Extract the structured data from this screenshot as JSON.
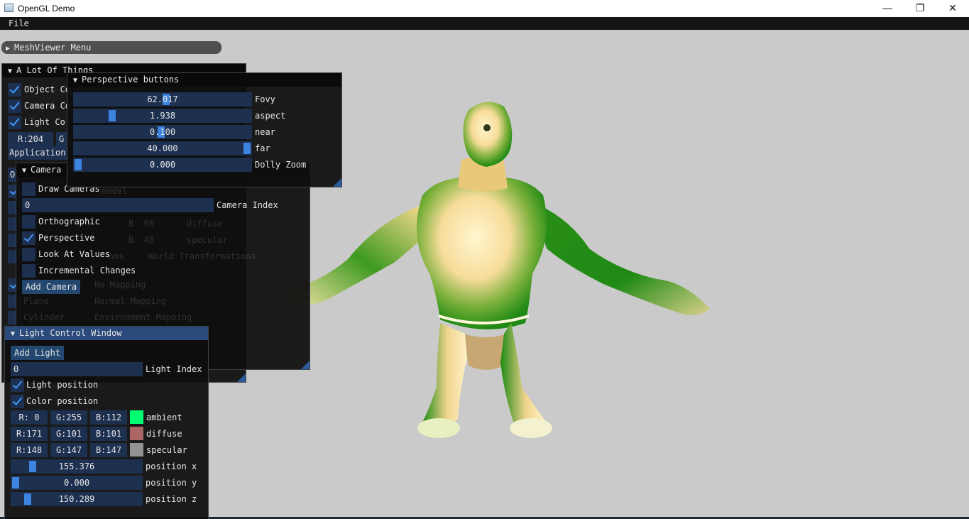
{
  "window": {
    "title": "OpenGL Demo",
    "minimize": "—",
    "maximize": "❐",
    "close": "✕"
  },
  "menubar": {
    "file": "File"
  },
  "meshviewer_menu": {
    "title": "MeshViewer Menu"
  },
  "a_lot_of_things": {
    "title": "A Lot Of Things",
    "object_control": "Object Co",
    "camera_control": "Camera Co",
    "light_control": "Light Co",
    "r_value": "R:204",
    "g_partial": "G",
    "application": "Application",
    "o_partial": "O"
  },
  "perspective": {
    "title": "Perspective buttons",
    "sliders": [
      {
        "value": "62.017",
        "label": "Fovy",
        "level": 0.52
      },
      {
        "value": "1.938",
        "label": "aspect",
        "level": 0.2
      },
      {
        "value": "0.100",
        "label": "near",
        "level": 0.49
      },
      {
        "value": "40.000",
        "label": "far",
        "level": 1.0
      },
      {
        "value": "0.000",
        "label": "Dolly Zoom",
        "level": 0.0
      }
    ]
  },
  "camera": {
    "title": "Camera C",
    "draw_cameras": "Draw Cameras",
    "camera_index_value": "0",
    "camera_index_label": "Camera Index",
    "orthographic": "Orthographic",
    "perspective": "Perspective",
    "look_at": "Look At Values",
    "incremental": "Incremental Changes",
    "add_camera": "Add Camera"
  },
  "ghost_text": {
    "model": "model",
    "b60": "B: 60",
    "diffuse": "diffuse",
    "b48": "B: 48",
    "specular": "specular",
    "ons": "ons",
    "world_transformations": "World Transformations",
    "no_mapping": "No Mapping",
    "plane": "Plane",
    "normal_mapping": "Normal Mapping",
    "cylinder": "Cylinder",
    "environment_mapping": "Environment Mapping"
  },
  "light": {
    "title": "Light Control Window",
    "add_light": "Add Light",
    "light_index_value": "0",
    "light_index_label": "Light Index",
    "light_position": "Light position",
    "color_position": "Color position",
    "colors": [
      {
        "r": "R:  0",
        "g": "G:255",
        "b": "B:112",
        "swatch": "#00ff70",
        "label": "ambient"
      },
      {
        "r": "R:171",
        "g": "G:101",
        "b": "B:101",
        "swatch": "#ab6565",
        "label": "diffuse"
      },
      {
        "r": "R:148",
        "g": "G:147",
        "b": "B:147",
        "swatch": "#949393",
        "label": "specular"
      }
    ],
    "positions": [
      {
        "value": "155.376",
        "label": "position x",
        "level": 0.14
      },
      {
        "value": "0.000",
        "label": "position y",
        "level": 0.0
      },
      {
        "value": "150.289",
        "label": "position z",
        "level": 0.1
      }
    ]
  },
  "colors": {
    "accent": "#4296fa",
    "frame": "#1d3050",
    "button": "#24476f",
    "title_active": "#294a7a",
    "mesh_green": "#1f8a14",
    "mesh_cream": "#ffedbc"
  }
}
